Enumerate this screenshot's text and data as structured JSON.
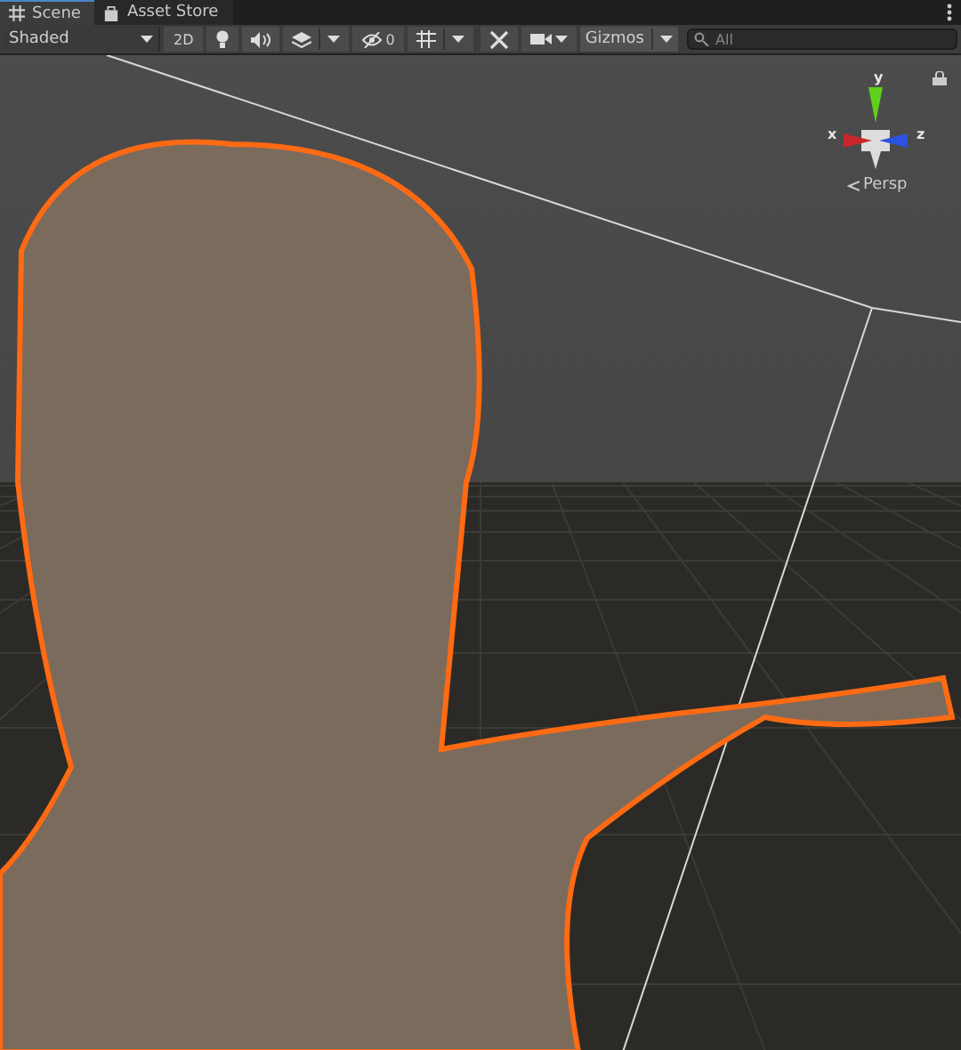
{
  "tabs": [
    {
      "label": "Scene",
      "selected": true
    },
    {
      "label": "Asset Store",
      "selected": false
    }
  ],
  "toolbar": {
    "shading_mode": "Shaded",
    "mode_2d": "2D",
    "audio_on": true,
    "hidden_count": "0",
    "gizmos": "Gizmos",
    "search": {
      "placeholder": "All"
    }
  },
  "orientation_gizmo": {
    "axes": [
      {
        "label": "y",
        "color": "#5fd01c"
      },
      {
        "label": "x",
        "color": "#c8262a"
      },
      {
        "label": "z",
        "color": "#2b52e0"
      }
    ],
    "projection": "Persp"
  }
}
